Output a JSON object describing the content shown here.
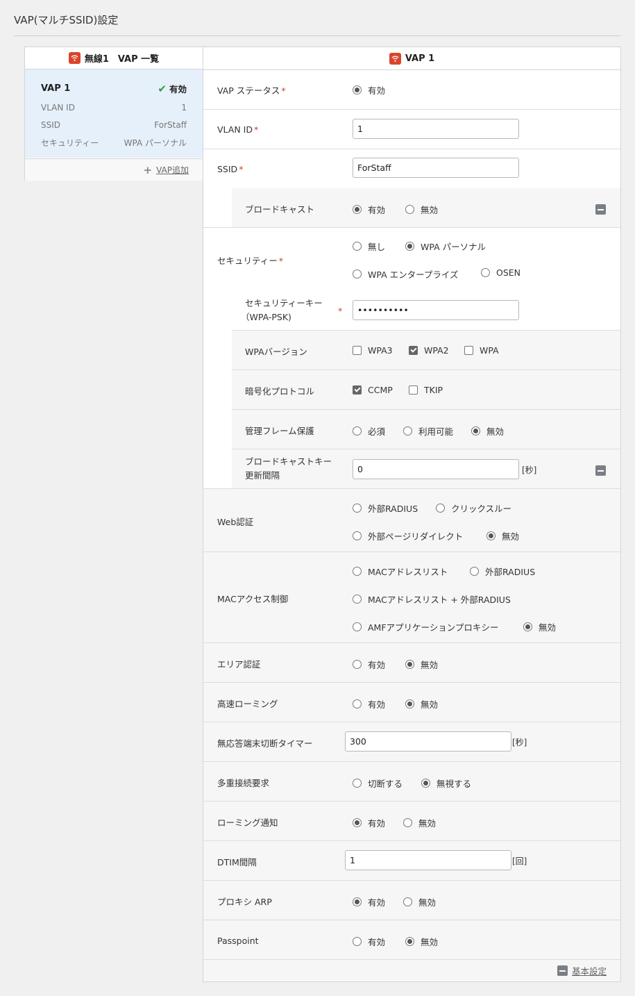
{
  "page_title": "VAP(マルチSSID)設定",
  "colors": {
    "accent_icon": "#d9452a",
    "status_ok": "#2e9e44",
    "required": "#d23b2e",
    "selected_card": "#e6f0fa"
  },
  "vap_list": {
    "header": "無線1　VAP 一覧",
    "card": {
      "name": "VAP 1",
      "status": "有効",
      "rows": [
        {
          "label": "VLAN ID",
          "value": "1"
        },
        {
          "label": "SSID",
          "value": "ForStaff"
        },
        {
          "label": "セキュリティー",
          "value": "WPA パーソナル"
        }
      ]
    },
    "add_label": "VAP追加"
  },
  "form": {
    "header": "VAP 1",
    "vap_status": {
      "label": "VAP ステータス",
      "options": [
        "有効"
      ],
      "selected": 0
    },
    "vlan_id": {
      "label": "VLAN ID",
      "value": "1"
    },
    "ssid": {
      "label": "SSID",
      "value": "ForStaff"
    },
    "broadcast": {
      "label": "ブロードキャスト",
      "options": [
        "有効",
        "無効"
      ],
      "selected": 0
    },
    "security": {
      "label": "セキュリティー",
      "options": [
        "無し",
        "WPA パーソナル",
        "WPA エンタープライズ",
        "OSEN"
      ],
      "selected": 1
    },
    "security_key": {
      "label_line1": "セキュリティーキー",
      "label_line2": "（WPA-PSK)",
      "value": "••••••••••"
    },
    "wpa_version": {
      "label": "WPAバージョン",
      "options": [
        "WPA3",
        "WPA2",
        "WPA"
      ],
      "checked": [
        false,
        true,
        false
      ]
    },
    "encryption": {
      "label": "暗号化プロトコル",
      "options": [
        "CCMP",
        "TKIP"
      ],
      "checked": [
        true,
        false
      ]
    },
    "mgmt_frame": {
      "label": "管理フレーム保護",
      "options": [
        "必須",
        "利用可能",
        "無効"
      ],
      "selected": 2
    },
    "bcast_key": {
      "label_line1": "ブロードキャストキー",
      "label_line2": "更新間隔",
      "value": "0",
      "unit": "[秒]"
    },
    "web_auth": {
      "label": "Web認証",
      "options": [
        "外部RADIUS",
        "クリックスルー",
        "外部ページリダイレクト",
        "無効"
      ],
      "selected": 3
    },
    "mac_access": {
      "label": "MACアクセス制御",
      "options": [
        "MACアドレスリスト",
        "外部RADIUS",
        "MACアドレスリスト + 外部RADIUS",
        "AMFアプリケーションプロキシー",
        "無効"
      ],
      "selected": 4
    },
    "area_auth": {
      "label": "エリア認証",
      "options": [
        "有効",
        "無効"
      ],
      "selected": 1
    },
    "fast_roaming": {
      "label": "高速ローミング",
      "options": [
        "有効",
        "無効"
      ],
      "selected": 1
    },
    "idle_timer": {
      "label": "無応答端末切断タイマー",
      "value": "300",
      "unit": "[秒]"
    },
    "multi_conn": {
      "label": "多重接続要求",
      "options": [
        "切断する",
        "無視する"
      ],
      "selected": 1
    },
    "roaming_notify": {
      "label": "ローミング通知",
      "options": [
        "有効",
        "無効"
      ],
      "selected": 0
    },
    "dtim": {
      "label": "DTIM間隔",
      "value": "1",
      "unit": "[回]"
    },
    "proxy_arp": {
      "label": "プロキシ ARP",
      "options": [
        "有効",
        "無効"
      ],
      "selected": 0
    },
    "passpoint": {
      "label": "Passpoint",
      "options": [
        "有効",
        "無効"
      ],
      "selected": 1
    },
    "basic_settings": "基本設定"
  }
}
